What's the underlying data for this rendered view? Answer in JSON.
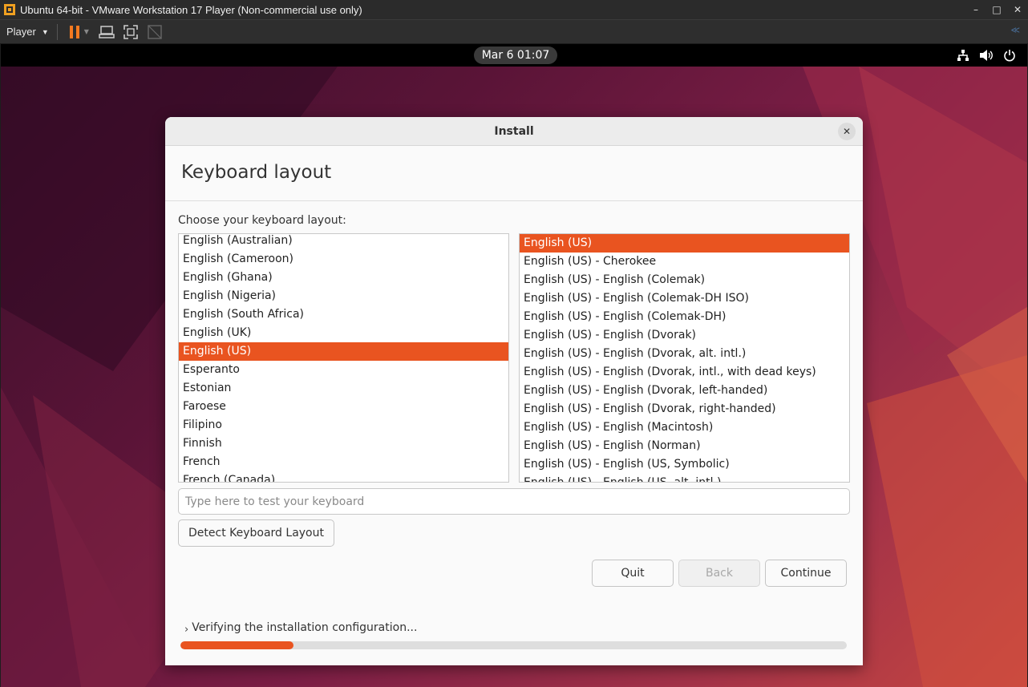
{
  "vm": {
    "window_title": "Ubuntu 64-bit - VMware Workstation 17 Player (Non-commercial use only)",
    "player_menu_label": "Player",
    "window_controls": {
      "minimize": "–",
      "maximize": "□",
      "close": "✕"
    },
    "toolbar_icons": [
      "pause-icon",
      "send-ctrl-alt-del-icon",
      "fullscreen-icon",
      "unity-icon"
    ]
  },
  "topbar": {
    "clock": "Mar 6  01:07",
    "tray_icons": [
      "network-icon",
      "volume-icon",
      "power-icon"
    ]
  },
  "dialog": {
    "title": "Install",
    "close_glyph": "✕",
    "heading": "Keyboard layout",
    "choose_label": "Choose your keyboard layout:",
    "layouts": [
      "English (Australian)",
      "English (Cameroon)",
      "English (Ghana)",
      "English (Nigeria)",
      "English (South Africa)",
      "English (UK)",
      "English (US)",
      "Esperanto",
      "Estonian",
      "Faroese",
      "Filipino",
      "Finnish",
      "French",
      "French (Canada)"
    ],
    "selected_layout": "English (US)",
    "variants": [
      "English (US)",
      "English (US) - Cherokee",
      "English (US) - English (Colemak)",
      "English (US) - English (Colemak-DH ISO)",
      "English (US) - English (Colemak-DH)",
      "English (US) - English (Dvorak)",
      "English (US) - English (Dvorak, alt. intl.)",
      "English (US) - English (Dvorak, intl., with dead keys)",
      "English (US) - English (Dvorak, left-handed)",
      "English (US) - English (Dvorak, right-handed)",
      "English (US) - English (Macintosh)",
      "English (US) - English (Norman)",
      "English (US) - English (US, Symbolic)",
      "English (US) - English (US, alt. intl.)"
    ],
    "selected_variant": "English (US)",
    "test_input_placeholder": "Type here to test your keyboard",
    "test_input_value": "",
    "detect_button": "Detect Keyboard Layout",
    "quit_button": "Quit",
    "back_button": "Back",
    "continue_button": "Continue",
    "back_enabled": false,
    "status_text": "Verifying the installation configuration...",
    "progress_fraction": 0.17
  },
  "colors": {
    "accent": "#e95420",
    "vm_pause_orange": "#f57a20"
  }
}
